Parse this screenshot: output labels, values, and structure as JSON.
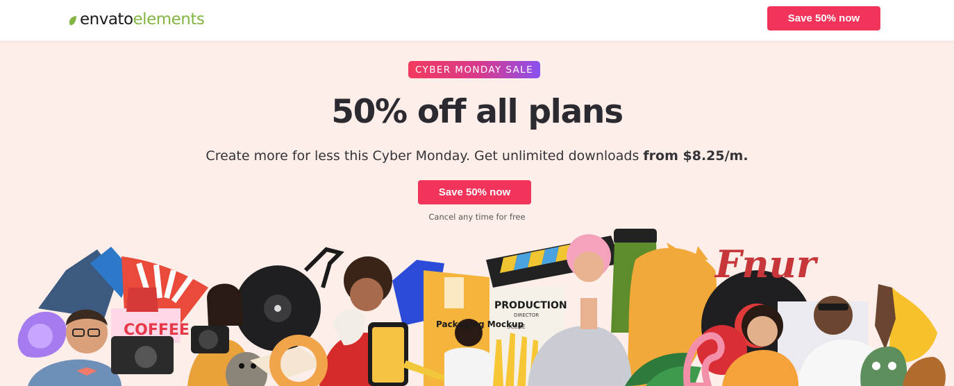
{
  "header": {
    "logo_word1": "envato",
    "logo_word2": "elements",
    "cta_label": "Save 50% now"
  },
  "hero": {
    "badge": "CYBER MONDAY SALE",
    "title": "50% off all plans",
    "subtitle_prefix": "Create more for less this Cyber Monday. Get unlimited downloads ",
    "subtitle_bold": "from $8.25/m.",
    "cta_label": "Save 50% now",
    "note": "Cancel any time for free"
  },
  "collage": {
    "sign_text": "Fnur",
    "clapper_title": "PRODUCTION",
    "clapper_line1": "DIRECTOR",
    "clapper_line2": "SCENE",
    "bag_text": "Packaging Mockup",
    "coffee_text": "COFFEE"
  },
  "colors": {
    "accent": "#f2345a",
    "brand_green": "#82b541",
    "background": "#fdeee9"
  }
}
